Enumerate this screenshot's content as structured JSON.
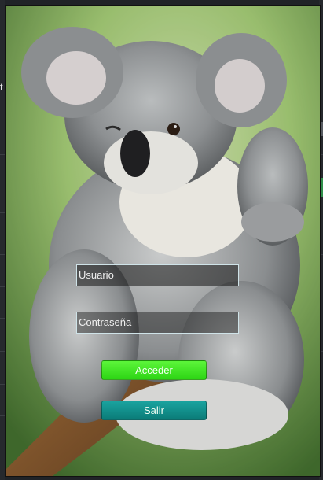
{
  "login": {
    "username_placeholder": "Usuario",
    "password_placeholder": "Contraseña",
    "login_button": "Acceder",
    "exit_button": "Salir"
  },
  "background_app": {
    "left_edge_text": "t"
  },
  "colors": {
    "login_button": "#36e01e",
    "exit_button": "#11908c",
    "field_border": "#cfe3e8"
  }
}
